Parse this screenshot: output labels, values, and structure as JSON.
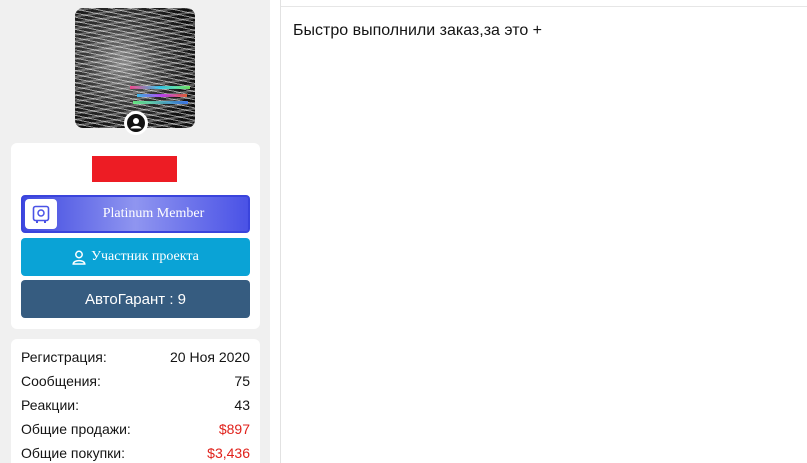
{
  "user": {
    "avatar_alt": "",
    "badges": {
      "platinum": "Platinum Member",
      "member": "Участник проекта",
      "garant": "АвтоГарант : 9"
    }
  },
  "stats": [
    {
      "label": "Регистрация:",
      "value": "20 Ноя 2020",
      "accent": false
    },
    {
      "label": "Сообщения:",
      "value": "75",
      "accent": false
    },
    {
      "label": "Реакции:",
      "value": "43",
      "accent": false
    },
    {
      "label": "Общие продажи:",
      "value": "$897",
      "accent": true
    },
    {
      "label": "Общие покупки:",
      "value": "$3,436",
      "accent": true
    }
  ],
  "post": {
    "message": "Быстро выполнили заказ,за это +"
  },
  "colors": {
    "redacted_name": "#ed1c24",
    "platinum": "#3f49e0",
    "member": "#0aa3d6",
    "garant": "#365c80",
    "money": "#e0211b"
  }
}
